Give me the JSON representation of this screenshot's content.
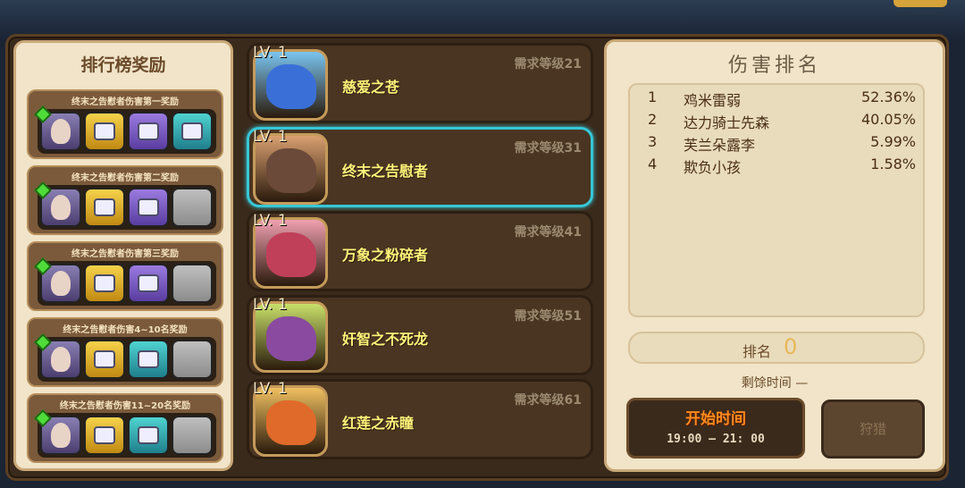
{
  "rewards": {
    "title": "排行榜奖励",
    "cards": [
      {
        "label": "终末之告慰者伤害第一奖励",
        "slots": [
          "hero",
          "gold",
          "purple",
          "teal"
        ]
      },
      {
        "label": "终末之告慰者伤害第二奖励",
        "slots": [
          "hero",
          "gold",
          "purple",
          "empty"
        ]
      },
      {
        "label": "终末之告慰者伤害第三奖励",
        "slots": [
          "hero",
          "gold",
          "purple",
          "empty"
        ]
      },
      {
        "label": "终末之告慰者伤害4~10名奖励",
        "slots": [
          "hero",
          "gold",
          "teal",
          "empty"
        ]
      },
      {
        "label": "终末之告慰者伤害11~20名奖励",
        "slots": [
          "hero",
          "gold",
          "teal",
          "empty"
        ]
      }
    ]
  },
  "bosses": [
    {
      "level": "LV. 1",
      "name": "慈爱之苍",
      "requirement": "需求等级21",
      "selected": false
    },
    {
      "level": "LV. 1",
      "name": "终末之告慰者",
      "requirement": "需求等级31",
      "selected": true
    },
    {
      "level": "LV. 1",
      "name": "万象之粉碎者",
      "requirement": "需求等级41",
      "selected": false
    },
    {
      "level": "LV. 1",
      "name": "奸智之不死龙",
      "requirement": "需求等级51",
      "selected": false
    },
    {
      "level": "LV. 1",
      "name": "红莲之赤瞳",
      "requirement": "需求等级61",
      "selected": false
    }
  ],
  "damage": {
    "title": "伤害排名",
    "rows": [
      {
        "rank": "1",
        "name": "鸡米雷弱",
        "percent": "52.36%"
      },
      {
        "rank": "2",
        "name": "达力骑士先森",
        "percent": "40.05%"
      },
      {
        "rank": "3",
        "name": "芙兰朵露李",
        "percent": "5.99%"
      },
      {
        "rank": "4",
        "name": "欺负小孩",
        "percent": "1.58%"
      }
    ],
    "my_rank_label": "排名",
    "my_rank_value": "0",
    "remaining_label": "剩馀时间 —",
    "start_label": "开始时间",
    "start_time": "19:00   —   21: 00",
    "hunt_button": "狩猎"
  },
  "colors": {
    "selected_outline": "#36c7d8",
    "boss_name": "#fff47a",
    "start_text": "#ff8b1f"
  }
}
